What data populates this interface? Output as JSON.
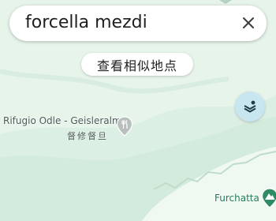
{
  "search": {
    "query": "forcella mezdi",
    "clear_icon": "close-icon"
  },
  "similar_places_label": "查看相似地点",
  "layers_button_icon": "layers-icon",
  "pois": [
    {
      "name": "Rifugio Odle - Geisleralm",
      "subtitle": "督修督旦",
      "icon": "restaurant-icon"
    },
    {
      "name": "Furchatta",
      "icon": "mountain-icon"
    }
  ],
  "colors": {
    "map_background": "#dcefe4",
    "terrain_light": "#eef7f1",
    "terrain_green": "#cbe6d5",
    "poi_green": "#1e7d54",
    "layers_button": "#c8e6ef"
  }
}
